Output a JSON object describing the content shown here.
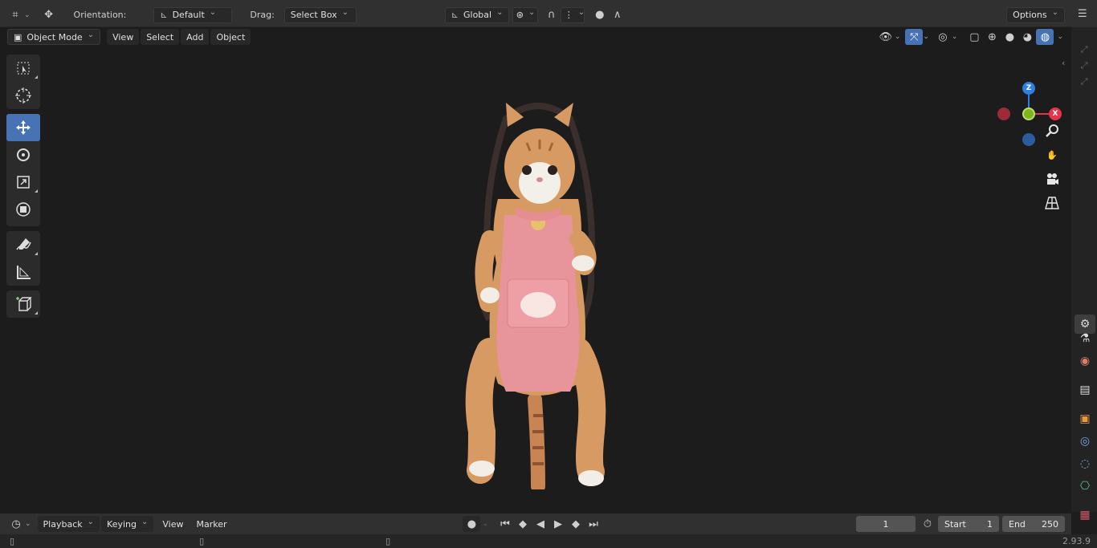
{
  "tool_header": {
    "orientation_label": "Orientation:",
    "orientation_value": "Default",
    "drag_label": "Drag:",
    "drag_value": "Select Box",
    "transform_orientation": "Global",
    "options_label": "Options"
  },
  "viewport_header": {
    "mode": "Object Mode",
    "menus": [
      "View",
      "Select",
      "Add",
      "Object"
    ]
  },
  "gizmo": {
    "axes": [
      "Z",
      "X"
    ],
    "colors": {
      "x": "#e3364a",
      "y": "#7fb51f",
      "z": "#2f7fe0",
      "neg_x": "#9c2b3a",
      "neg_z": "#2b5d9c"
    }
  },
  "left_toolbar": {
    "tools": [
      "select-box-icon",
      "cursor-icon",
      "move-icon",
      "rotate-icon",
      "scale-icon",
      "transform-icon",
      "annotate-icon",
      "measure-icon",
      "add-cube-icon"
    ],
    "active_tool": "move-icon"
  },
  "properties_tabs": [
    "tool-icon",
    "render-icon",
    "output-icon",
    "view-layer-icon",
    "scene-icon",
    "world-icon",
    "object-icon",
    "modifier-icon",
    "particles-icon",
    "physics-icon",
    "constraints-icon",
    "data-icon",
    "texture-icon"
  ],
  "timeline": {
    "menus": [
      "Playback",
      "Keying",
      "View",
      "Marker"
    ],
    "current_frame": "1",
    "start_label": "Start",
    "start_value": "1",
    "end_label": "End",
    "end_value": "250"
  },
  "status": {
    "version": "2.93.9"
  },
  "colors": {
    "accent": "#4772b3",
    "header_bg": "#303030",
    "viewport_bg": "#1c1c1c"
  }
}
